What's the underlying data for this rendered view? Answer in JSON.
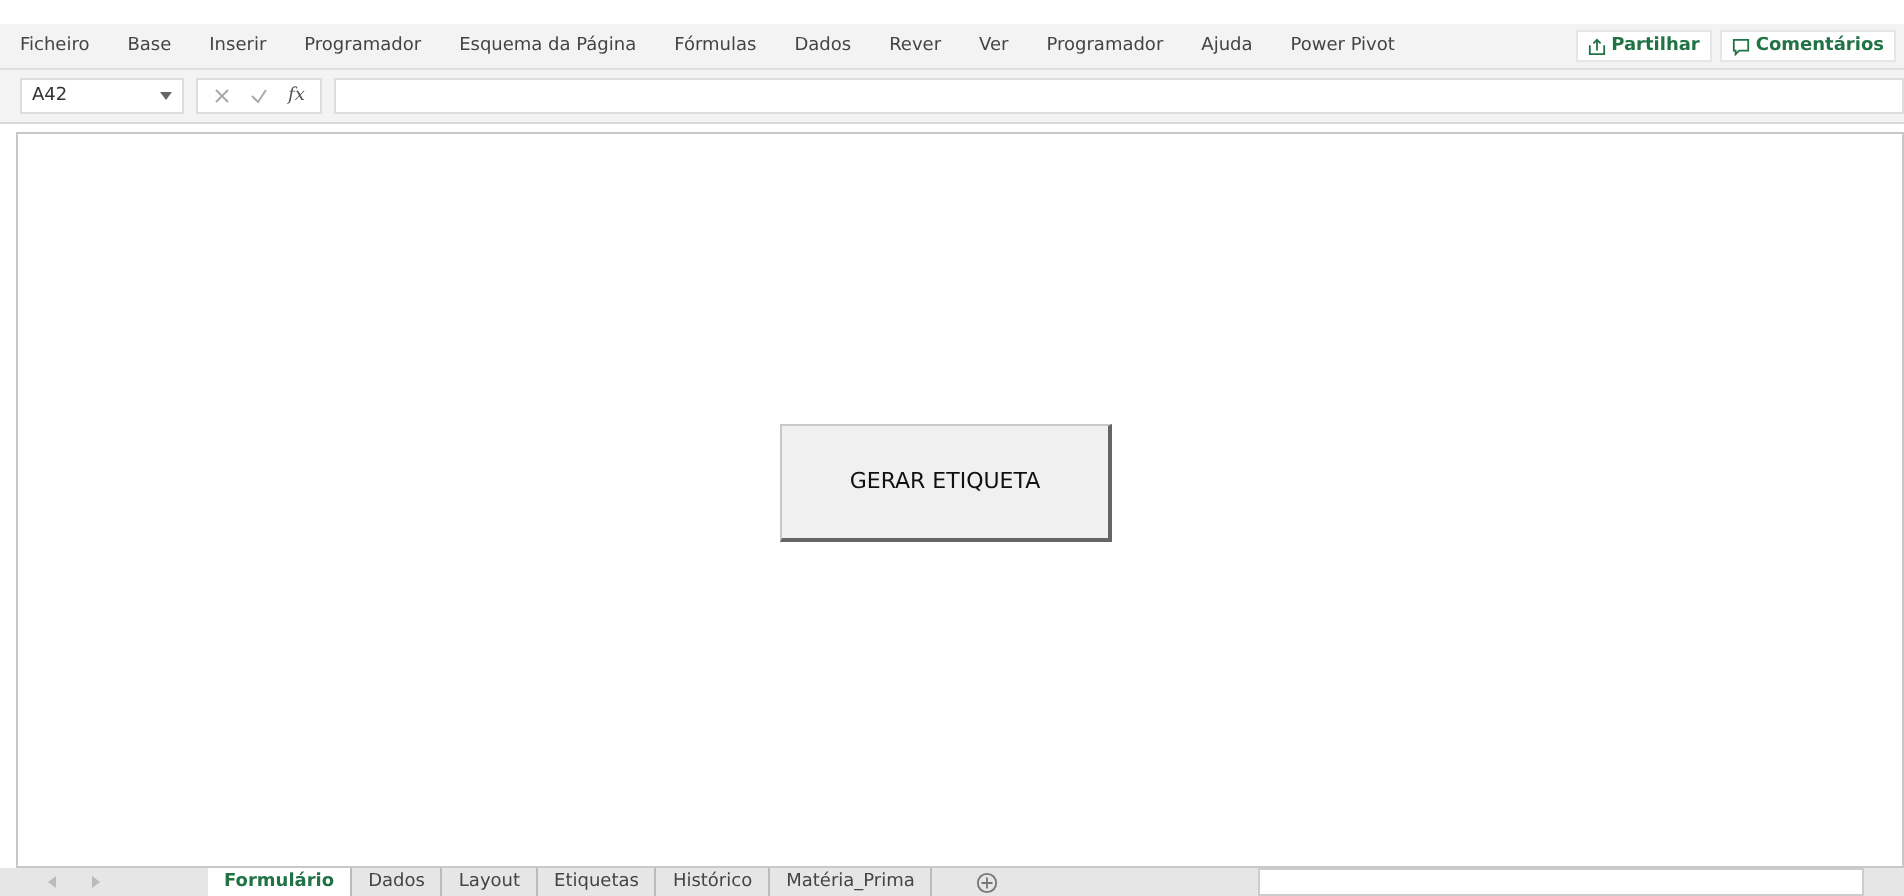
{
  "ribbon": {
    "tabs": [
      {
        "label": "Ficheiro",
        "selected": false
      },
      {
        "label": "Base",
        "selected": false
      },
      {
        "label": "Inserir",
        "selected": false
      },
      {
        "label": "Programador",
        "selected": false
      },
      {
        "label": "Esquema da Página",
        "selected": false
      },
      {
        "label": "Fórmulas",
        "selected": false
      },
      {
        "label": "Dados",
        "selected": false
      },
      {
        "label": "Rever",
        "selected": false
      },
      {
        "label": "Ver",
        "selected": false
      },
      {
        "label": "Programador",
        "selected": false
      },
      {
        "label": "Ajuda",
        "selected": false
      },
      {
        "label": "Power Pivot",
        "selected": false
      }
    ],
    "share": "Partilhar",
    "comments": "Comentários"
  },
  "formula_bar": {
    "name_box": "A42",
    "function_label": "fx"
  },
  "sheet": {
    "button": "GERAR ETIQUETA"
  },
  "sheet_tabs": [
    {
      "label": "Formulário",
      "selected": true
    },
    {
      "label": "Dados",
      "selected": false
    },
    {
      "label": "Layout",
      "selected": false
    },
    {
      "label": "Etiquetas",
      "selected": false
    },
    {
      "label": "Histórico",
      "selected": false
    },
    {
      "label": "Matéria_Prima",
      "selected": false
    }
  ]
}
